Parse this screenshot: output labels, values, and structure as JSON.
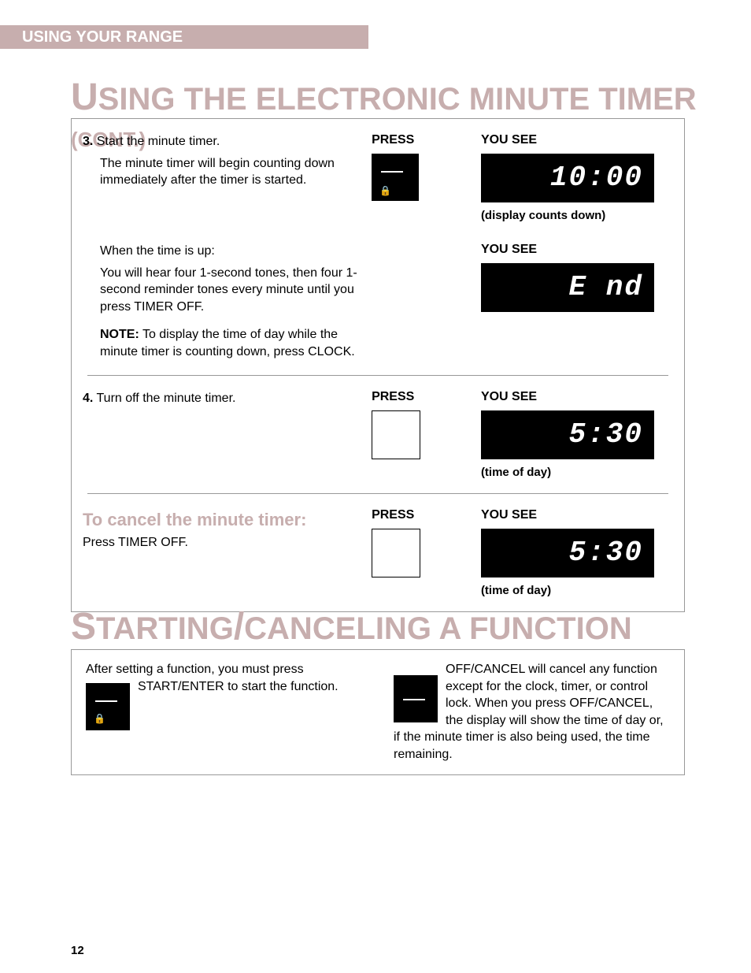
{
  "tab": "USING YOUR RANGE",
  "title1": {
    "bigU": "U",
    "rest": "SING THE ELECTRONIC MINUTE TIMER ",
    "cont": "(CONT.)"
  },
  "title2": {
    "bigS": "S",
    "rest1": "TARTING",
    "slash": "/",
    "rest2": "CANCELING A FUNCTION"
  },
  "labels": {
    "press": "PRESS",
    "yousee": "YOU SEE"
  },
  "step3": {
    "num": "3.",
    "head": " Start the minute timer.",
    "body": "The minute timer will begin counting down immediately after the timer is started.",
    "display": "10:00",
    "caption": "(display counts down)"
  },
  "timeup": {
    "head": "When the time is up:",
    "body": "You will hear four 1-second tones, then four 1-second reminder tones every minute until you press TIMER OFF.",
    "noteLabel": "NOTE:",
    "note": " To display the time of day while the minute timer is counting down, press CLOCK.",
    "display": "E nd"
  },
  "step4": {
    "num": "4.",
    "head": " Turn off the minute timer.",
    "display": "5:30",
    "caption": "(time of day)"
  },
  "cancel": {
    "head": "To cancel the minute timer:",
    "body": "Press TIMER OFF.",
    "display": "5:30",
    "caption": "(time of day)"
  },
  "box2": {
    "left": "After setting a function, you must press START/ENTER to start the function.",
    "right": "OFF/CANCEL will cancel any function except for the clock, timer, or control lock. When you press OFF/CANCEL, the display will show the time of day or, if the minute timer is also being used, the time remaining."
  },
  "pageNum": "12",
  "lockGlyph": "🔒"
}
